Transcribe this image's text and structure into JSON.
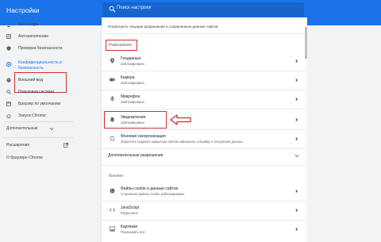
{
  "app": {
    "title": "Настройки"
  },
  "search": {
    "placeholder": "Поиск настроек"
  },
  "sidebar": {
    "items": [
      {
        "label": "Я и Google",
        "icon": "person-icon"
      },
      {
        "label": "Автозаполнение",
        "icon": "autofill-icon"
      },
      {
        "label": "Проверка безопасности",
        "icon": "shield-icon"
      },
      {
        "label": "Конфиденциальность и безопасность",
        "line1": "Конфиденциальность и",
        "line2": "безопасность",
        "icon": "shield-lock-icon"
      },
      {
        "label": "Внешний вид",
        "icon": "palette-icon"
      },
      {
        "label": "Поисковая система",
        "icon": "search-icon"
      },
      {
        "label": "Браузер по умолчанию",
        "icon": "browser-icon"
      },
      {
        "label": "Запуск Chrome",
        "icon": "power-icon"
      }
    ],
    "additional": "Дополнительные",
    "extensions": "Расширения",
    "about": "О браузере Chrome"
  },
  "content": {
    "top_link": "Посмотреть текущие разрешения и сохраненные данные сайтов.",
    "permissions_header": "Разрешения",
    "permissions": [
      {
        "title": "Геоданные",
        "sub": "Заблокировано",
        "icon": "location-icon"
      },
      {
        "title": "Камера",
        "sub": "Заблокировано",
        "icon": "camera-icon"
      },
      {
        "title": "Микрофон",
        "sub": "Заблокировано",
        "icon": "microphone-icon"
      },
      {
        "title": "Уведомления",
        "sub": "Заблокировано",
        "icon": "bell-icon"
      },
      {
        "title": "Фоновая синхронизация",
        "sub": "Запретить недавно закрытым сайтам завершать отправку и получение данных",
        "icon": "sync-icon"
      }
    ],
    "additional_permissions": "Дополнительные разрешения",
    "content_header": "Контент",
    "content_items": [
      {
        "title": "Файлы cookie и данные сайтов",
        "sub": "Сторонние файлы cookie заблокированы.",
        "icon": "cookie-icon"
      },
      {
        "title": "JavaScript",
        "sub": "Разрешено",
        "icon": "code-icon"
      },
      {
        "title": "Картинки",
        "sub": "Показывать все",
        "icon": "image-icon"
      }
    ]
  },
  "colors": {
    "accent": "#1a73e8",
    "highlight": "#d32f2f"
  }
}
